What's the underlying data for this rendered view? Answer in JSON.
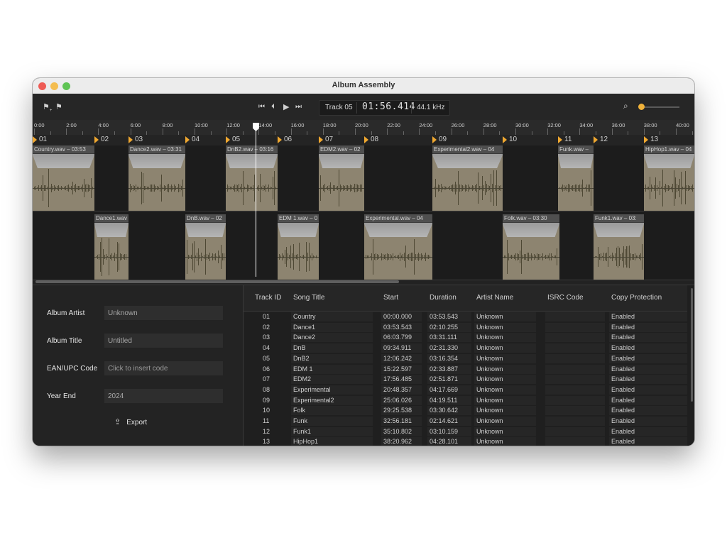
{
  "window": {
    "title": "Album Assembly"
  },
  "toolbar": {
    "flag_icons": [
      "flag-add-icon",
      "flag-icon"
    ],
    "transport_icons": [
      "skip-back-icon",
      "previous-icon",
      "play-icon",
      "skip-forward-icon"
    ],
    "track_label": "Track 05",
    "timecode": "01:56.414",
    "sample_rate": "44.1 kHz",
    "zoom_level": 0.05,
    "accent_color": "#f0b23a"
  },
  "ruler": {
    "ticks": [
      "0:00",
      "2:00",
      "4:00",
      "6:00",
      "8:00",
      "10:00",
      "12:00",
      "14:00",
      "16:00",
      "18:00",
      "20:00",
      "22:00",
      "24:00",
      "26:00",
      "28:00",
      "30:00",
      "32:00",
      "34:00",
      "36:00",
      "38:00",
      "40:00"
    ]
  },
  "markers": [
    "01",
    "02",
    "03",
    "04",
    "05",
    "06",
    "07",
    "08",
    "09",
    "10",
    "11",
    "12",
    "13"
  ],
  "clips": {
    "lane1": [
      "Country.wav – 03:53",
      "Dance2.wav – 03:31",
      "DnB2.wav – 03:16",
      "EDM2.wav – 02",
      "Experimental2.wav – 04",
      "Funk.wav –",
      "HipHop1.wav – 04"
    ],
    "lane2": [
      "Dance1.wav",
      "DnB.wav – 02",
      "EDM 1.wav – 0",
      "Experimental.wav – 04",
      "Folk.wav – 03:30",
      "Funk1.wav – 03:"
    ]
  },
  "form": {
    "album_artist_label": "Album Artist",
    "album_artist_value": "Unknown",
    "album_title_label": "Album Title",
    "album_title_value": "Untitled",
    "ean_label": "EAN/UPC Code",
    "ean_placeholder": "Click to insert code",
    "year_label": "Year End",
    "year_value": "2024",
    "export_label": "Export"
  },
  "table": {
    "columns": [
      "Track ID",
      "Song Title",
      "Start",
      "Duration",
      "Artist Name",
      "ISRC Code",
      "Copy Protection"
    ],
    "rows": [
      [
        "01",
        "Country",
        "00:00.000",
        "03:53.543",
        "Unknown",
        "",
        "Enabled"
      ],
      [
        "02",
        "Dance1",
        "03:53.543",
        "02:10.255",
        "Unknown",
        "",
        "Enabled"
      ],
      [
        "03",
        "Dance2",
        "06:03.799",
        "03:31.111",
        "Unknown",
        "",
        "Enabled"
      ],
      [
        "04",
        "DnB",
        "09:34.911",
        "02:31.330",
        "Unknown",
        "",
        "Enabled"
      ],
      [
        "05",
        "DnB2",
        "12:06.242",
        "03:16.354",
        "Unknown",
        "",
        "Enabled"
      ],
      [
        "06",
        "EDM 1",
        "15:22.597",
        "02:33.887",
        "Unknown",
        "",
        "Enabled"
      ],
      [
        "07",
        "EDM2",
        "17:56.485",
        "02:51.871",
        "Unknown",
        "",
        "Enabled"
      ],
      [
        "08",
        "Experimental",
        "20:48.357",
        "04:17.669",
        "Unknown",
        "",
        "Enabled"
      ],
      [
        "09",
        "Experimental2",
        "25:06.026",
        "04:19.511",
        "Unknown",
        "",
        "Enabled"
      ],
      [
        "10",
        "Folk",
        "29:25.538",
        "03:30.642",
        "Unknown",
        "",
        "Enabled"
      ],
      [
        "11",
        "Funk",
        "32:56.181",
        "02:14.621",
        "Unknown",
        "",
        "Enabled"
      ],
      [
        "12",
        "Funk1",
        "35:10.802",
        "03:10.159",
        "Unknown",
        "",
        "Enabled"
      ],
      [
        "13",
        "HipHop1",
        "38:20.962",
        "04:28.101",
        "Unknown",
        "",
        "Enabled"
      ]
    ]
  }
}
